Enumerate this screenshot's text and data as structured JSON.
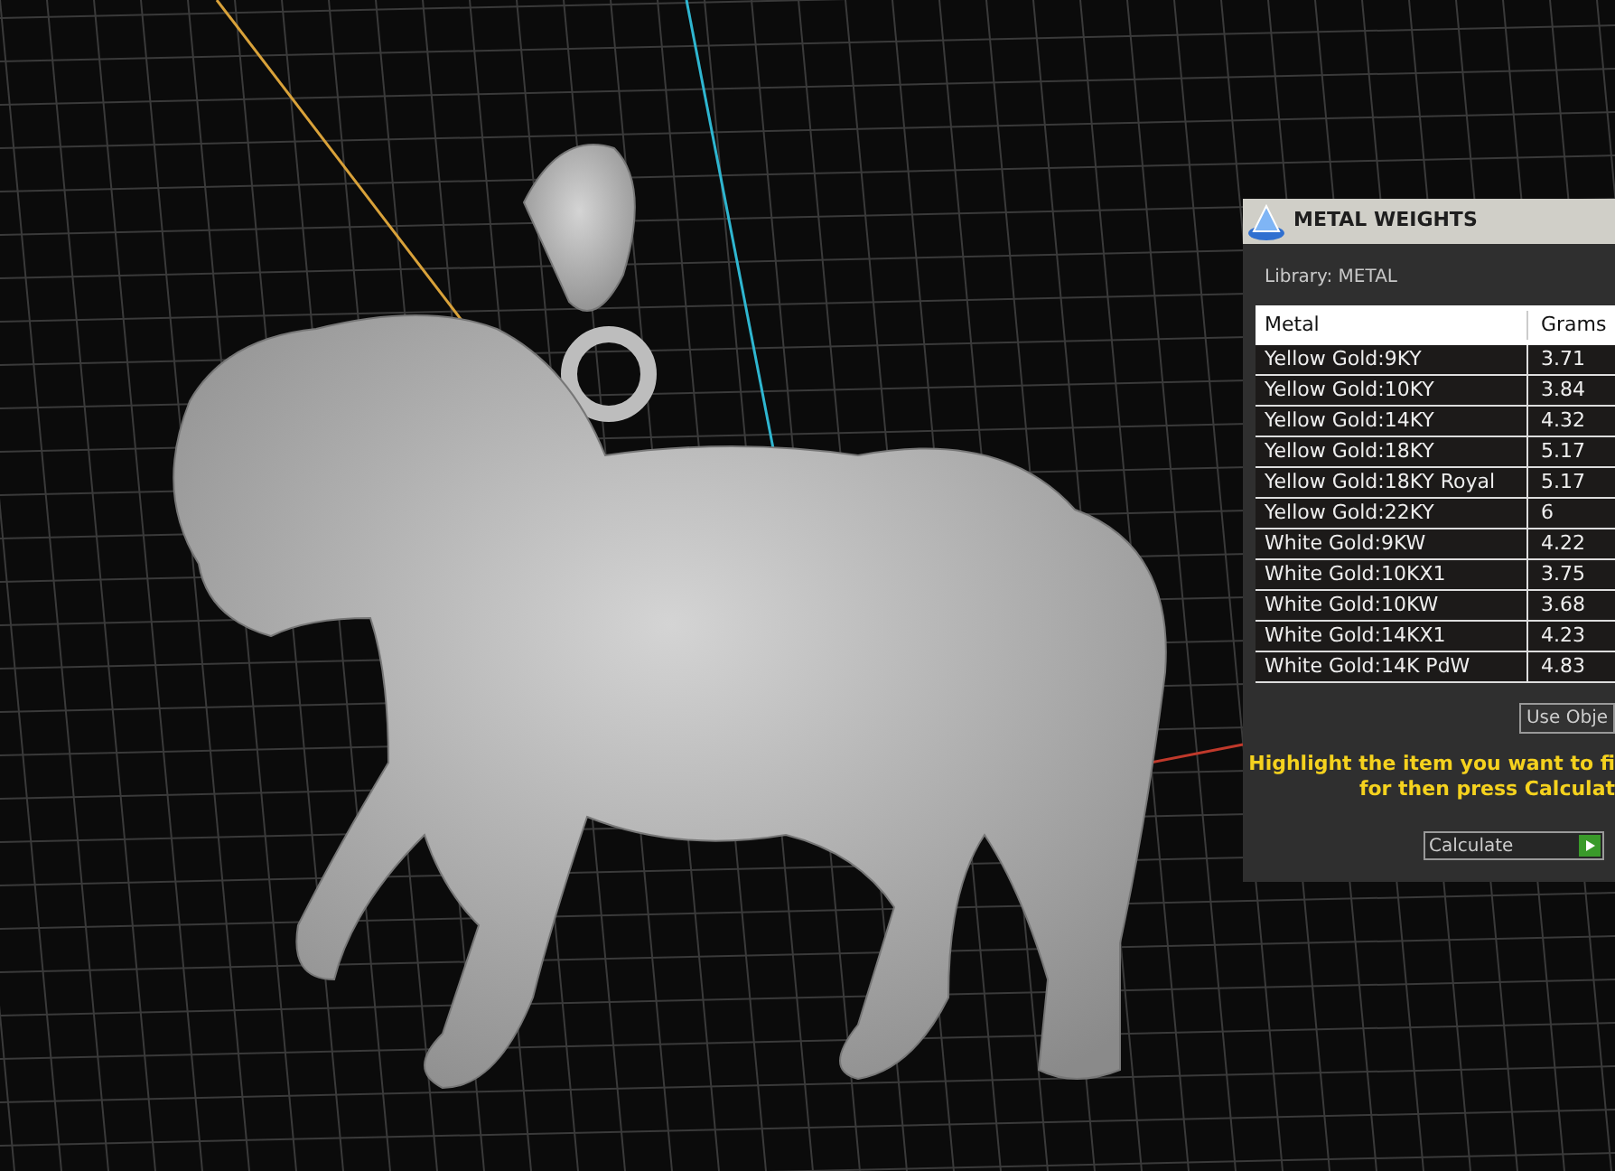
{
  "panel": {
    "title": "METAL WEIGHTS",
    "library_label": "Library: METAL",
    "table": {
      "columns": [
        "Metal",
        "Grams"
      ],
      "rows": [
        {
          "metal": "Yellow Gold:9KY",
          "grams": "3.71"
        },
        {
          "metal": "Yellow Gold:10KY",
          "grams": "3.84"
        },
        {
          "metal": "Yellow Gold:14KY",
          "grams": "4.32"
        },
        {
          "metal": "Yellow Gold:18KY",
          "grams": "5.17"
        },
        {
          "metal": "Yellow Gold:18KY Royal",
          "grams": "5.17"
        },
        {
          "metal": "Yellow Gold:22KY",
          "grams": "6"
        },
        {
          "metal": "White Gold:9KW",
          "grams": "4.22"
        },
        {
          "metal": "White Gold:10KX1",
          "grams": "3.75"
        },
        {
          "metal": "White Gold:10KW",
          "grams": "3.68"
        },
        {
          "metal": "White Gold:14KX1",
          "grams": "4.23"
        },
        {
          "metal": "White Gold:14K PdW",
          "grams": "4.83"
        }
      ]
    },
    "use_object_button": "Use Obje",
    "instructions": [
      "Highlight the item you want to fi",
      "for then press Calculat"
    ],
    "calculate_button": "Calculate"
  }
}
